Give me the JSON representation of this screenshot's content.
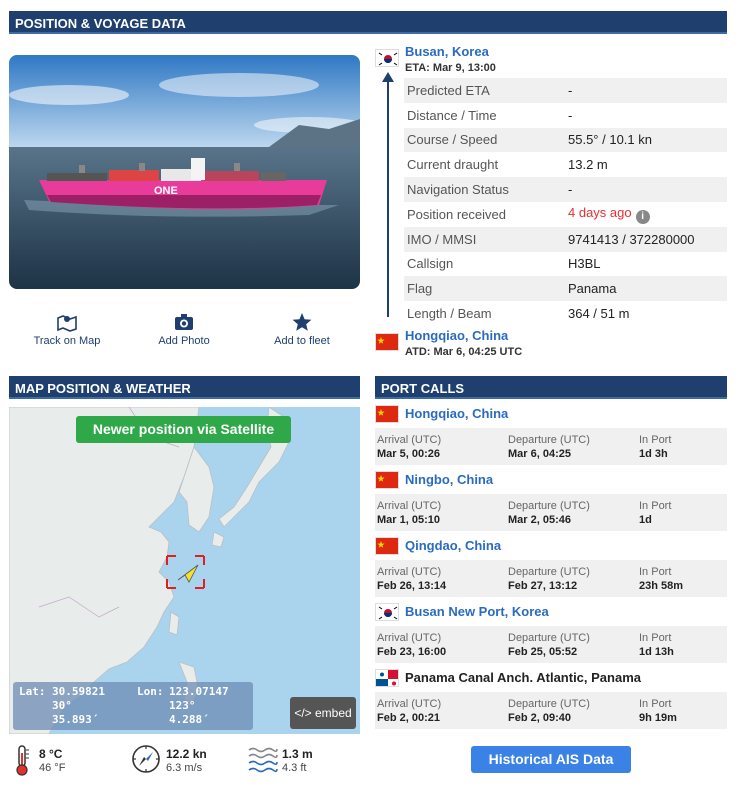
{
  "sections": {
    "position": "POSITION & VOYAGE DATA",
    "map": "MAP POSITION & WEATHER",
    "port_calls": "PORT CALLS"
  },
  "actions": [
    {
      "label": "Track on Map",
      "icon": "map-icon"
    },
    {
      "label": "Add Photo",
      "icon": "camera-icon"
    },
    {
      "label": "Add to fleet",
      "icon": "star-icon"
    }
  ],
  "ship_photo": {
    "hull_text": "ONE",
    "hull_color": "#e83b9a"
  },
  "voyage": {
    "destination": {
      "name": "Busan, Korea",
      "sub": "ETA: Mar 9, 13:00",
      "flag": "korea"
    },
    "origin": {
      "name": "Hongqiao, China",
      "sub": "ATD: Mar 6, 04:25 UTC",
      "flag": "china"
    },
    "rows": [
      {
        "key": "Predicted ETA",
        "value": "-"
      },
      {
        "key": "Distance / Time",
        "value": "-"
      },
      {
        "key": "Course / Speed",
        "value": "55.5° / 10.1 kn"
      },
      {
        "key": "Current draught",
        "value": "13.2 m"
      },
      {
        "key": "Navigation Status",
        "value": "-"
      },
      {
        "key": "Position received",
        "value": "4 days ago",
        "highlight": "#e53030",
        "info_icon": "i"
      },
      {
        "key": "IMO / MMSI",
        "value": "9741413 / 372280000"
      },
      {
        "key": "Callsign",
        "value": "H3BL"
      },
      {
        "key": "Flag",
        "value": "Panama"
      },
      {
        "key": "Length / Beam",
        "value": "364 / 51 m"
      }
    ]
  },
  "map": {
    "satellite_button": "Newer position via Satellite",
    "embed_button": "</> embed",
    "lat_label": "Lat:",
    "lat_decimal": "30.59821",
    "lat_deg": "30°",
    "lat_min": "35.893´",
    "lon_label": "Lon:",
    "lon_decimal": "123.07147",
    "lon_deg": "123°",
    "lon_min": "4.288´"
  },
  "weather": {
    "temp_c": "8 °C",
    "temp_f": "46 °F",
    "wind_kn": "12.2 kn",
    "wind_ms": "6.3 m/s",
    "wave_m": "1.3 m",
    "wave_ft": "4.3 ft"
  },
  "port_calls": {
    "labels": {
      "arrival": "Arrival (UTC)",
      "departure": "Departure (UTC)",
      "in_port": "In Port"
    },
    "items": [
      {
        "port": "Hongqiao, China",
        "flag": "china",
        "arrival": "Mar 5, 00:26",
        "departure": "Mar 6, 04:25",
        "in_port": "1d 3h"
      },
      {
        "port": "Ningbo, China",
        "flag": "china",
        "arrival": "Mar 1, 05:10",
        "departure": "Mar 2, 05:46",
        "in_port": "1d"
      },
      {
        "port": "Qingdao, China",
        "flag": "china",
        "arrival": "Feb 26, 13:14",
        "departure": "Feb 27, 13:12",
        "in_port": "23h 58m"
      },
      {
        "port": "Busan New Port, Korea",
        "flag": "korea",
        "arrival": "Feb 23, 16:00",
        "departure": "Feb 25, 05:52",
        "in_port": "1d 13h"
      },
      {
        "port": "Panama Canal Anch. Atlantic, Panama",
        "flag": "panama",
        "arrival": "Feb 2, 00:21",
        "departure": "Feb 2, 09:40",
        "in_port": "9h 19m"
      }
    ],
    "historical_button": "Historical AIS Data"
  }
}
